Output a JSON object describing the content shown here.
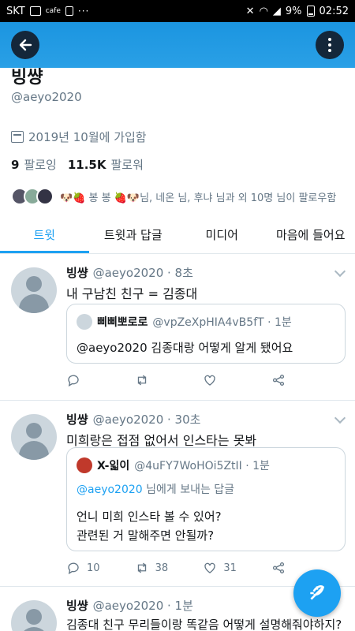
{
  "status_bar": {
    "carrier": "SKT",
    "cafe": "cafe",
    "dots": "···",
    "battery": "9%",
    "time": "02:52"
  },
  "profile": {
    "name": "빙썅",
    "handle": "@aeyo2020",
    "joined": "2019년 10월에 가입함",
    "following_count": "9",
    "following_label": "팔로잉",
    "followers_count": "11.5K",
    "followers_label": "팔로워",
    "known_followers": "🐶🍓 봉 봉 🍓🐶님, 네온 님, 후냐 님과 외 10명 님이 팔로우함"
  },
  "tabs": [
    "트윗",
    "트윗과 답글",
    "미디어",
    "마음에 들어요"
  ],
  "tweets": [
    {
      "name": "빙썅",
      "meta": "@aeyo2020 · 8초",
      "text": "내 구남친 친구 = 김종대",
      "quote": {
        "name": "삐삐뽀로로",
        "meta": "@vpZeXpHIA4vB5fT · 1분",
        "text": "@aeyo2020 김종대랑 어떻게 알게 됐어요"
      }
    },
    {
      "name": "빙썅",
      "meta": "@aeyo2020 · 30초",
      "text": "미희랑은 접점 없어서 인스타는 못봐",
      "quote": {
        "name": "X-읿이",
        "meta": "@4uFY7WoHOi5ZtII · 1분",
        "reply_handle": "@aeyo2020",
        "reply_suffix": " 님에게 보내는 답글",
        "line1": "언니 미희 인스타 볼 수 있어?",
        "line2": "관련된 거 말해주면 안될까?"
      },
      "replies": "10",
      "retweets": "38",
      "likes": "31"
    },
    {
      "name": "빙썅",
      "meta": "@aeyo2020 · 1분",
      "text": "김종대 친구 무리들이랑 똑같음 어떻게 설명해줘야하지?"
    }
  ],
  "colors": {
    "accent": "#1da1f2",
    "header": "#1b95e0"
  }
}
